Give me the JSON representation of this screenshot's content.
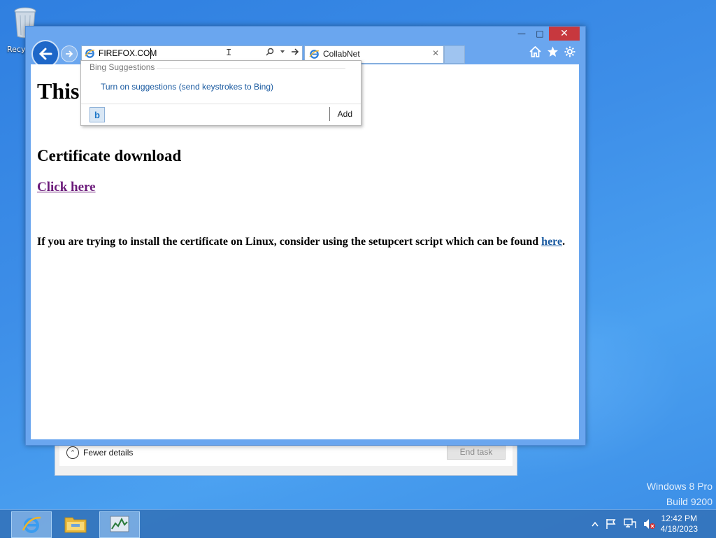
{
  "desktop": {
    "recycle_bin_label": "Recy",
    "watermark": {
      "line1": "Windows 8 Pro",
      "line2": "Build 9200"
    }
  },
  "task_manager": {
    "fewer_details": "Fewer details",
    "end_task": "End task"
  },
  "browser": {
    "address_value": "FIREFOX.COM",
    "tab_title": "CollabNet",
    "dropdown": {
      "header": "Bing Suggestions",
      "item": "Turn on suggestions (send keystrokes to Bing)",
      "add": "Add",
      "bing_letter": "b"
    },
    "page": {
      "heading_partial": "This",
      "section_title": "Certificate download",
      "click_here": "Click here",
      "linux_text": "If you are trying to install the certificate on Linux, consider using the setupcert script which can be found",
      "here_link": "here",
      "period": "."
    }
  },
  "taskbar": {
    "time": "12:42 PM",
    "date": "4/18/2023"
  },
  "colors": {
    "close_button": "#c7383e",
    "link_visited": "#6b1a7a",
    "link": "#1a5aa0"
  }
}
